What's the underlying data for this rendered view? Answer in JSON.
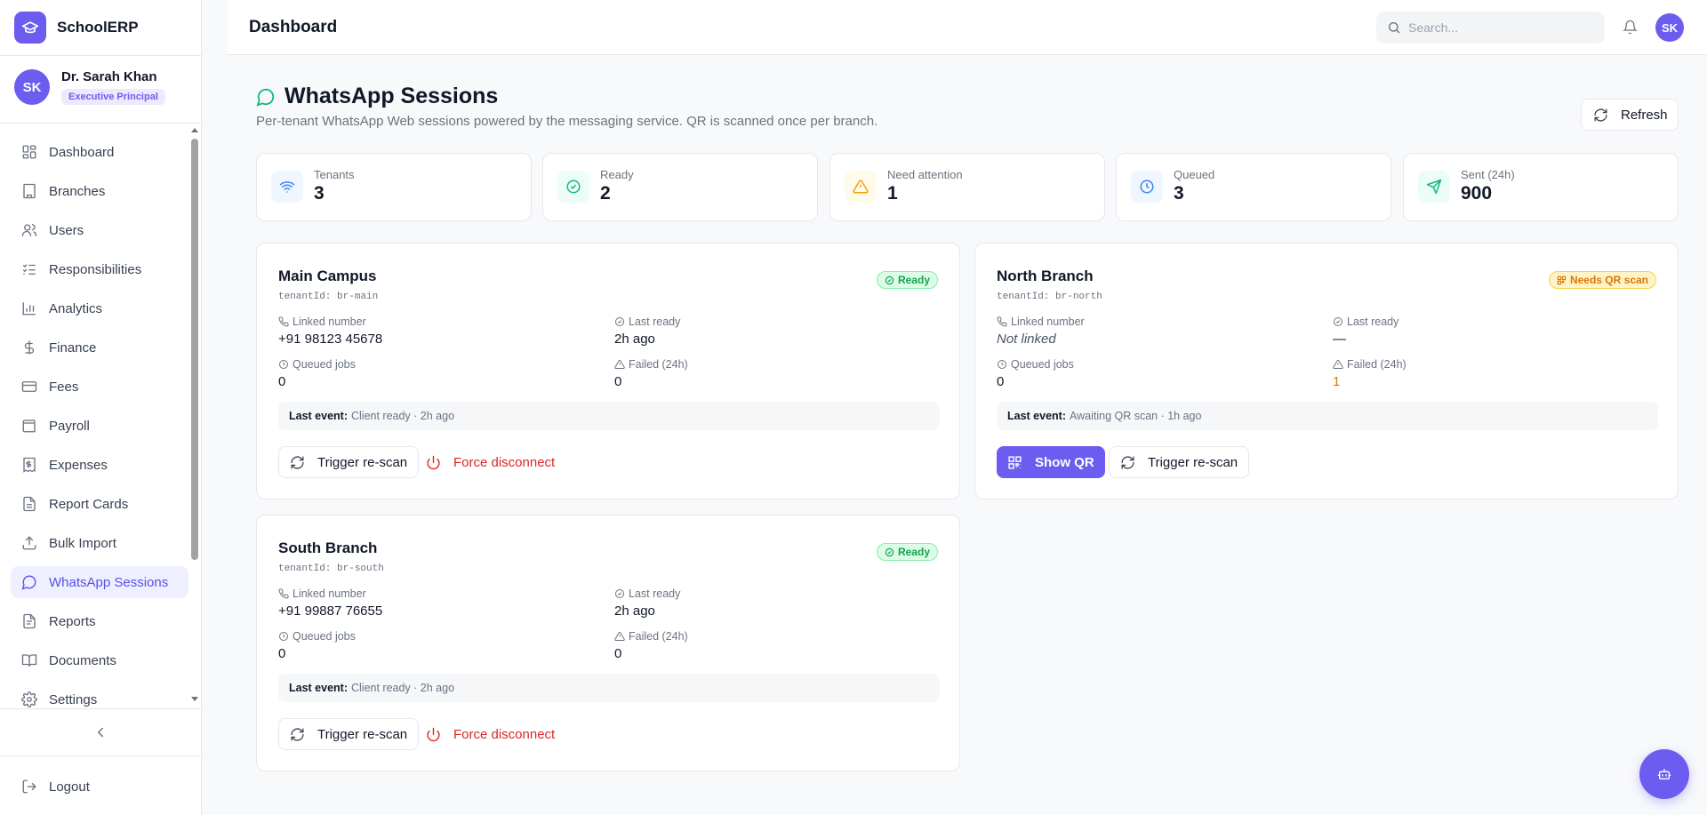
{
  "app": {
    "name": "SchoolERP",
    "brand_color": "#6d5cf0"
  },
  "profile": {
    "initials": "SK",
    "name": "Dr. Sarah Khan",
    "role": "Executive Principal"
  },
  "sidebar": {
    "items": [
      {
        "label": "Dashboard",
        "icon": "dashboard-icon"
      },
      {
        "label": "Branches",
        "icon": "building-icon"
      },
      {
        "label": "Users",
        "icon": "users-icon"
      },
      {
        "label": "Responsibilities",
        "icon": "list-checks-icon"
      },
      {
        "label": "Analytics",
        "icon": "bar-chart-icon"
      },
      {
        "label": "Finance",
        "icon": "dollar-icon"
      },
      {
        "label": "Fees",
        "icon": "credit-card-icon"
      },
      {
        "label": "Payroll",
        "icon": "wallet-icon"
      },
      {
        "label": "Expenses",
        "icon": "receipt-icon"
      },
      {
        "label": "Report Cards",
        "icon": "file-text-icon"
      },
      {
        "label": "Bulk Import",
        "icon": "upload-icon"
      },
      {
        "label": "WhatsApp Sessions",
        "icon": "message-circle-icon",
        "active": true
      },
      {
        "label": "Reports",
        "icon": "file-icon"
      },
      {
        "label": "Documents",
        "icon": "book-icon"
      },
      {
        "label": "Settings",
        "icon": "gear-icon"
      }
    ],
    "logout_label": "Logout"
  },
  "header": {
    "title": "Dashboard",
    "search_placeholder": "Search...",
    "avatar_initials": "SK"
  },
  "page": {
    "title": "WhatsApp Sessions",
    "subtitle": "Per-tenant WhatsApp Web sessions powered by the messaging service. QR is scanned once per branch.",
    "refresh_label": "Refresh"
  },
  "stats": [
    {
      "label": "Tenants",
      "value": "3",
      "icon": "wifi-icon",
      "color": "#3b82f6",
      "bg": "#eff6ff"
    },
    {
      "label": "Ready",
      "value": "2",
      "icon": "check-circle-icon",
      "color": "#10b981",
      "bg": "#ecfdf5"
    },
    {
      "label": "Need attention",
      "value": "1",
      "icon": "alert-triangle-icon",
      "color": "#f59e0b",
      "bg": "#fffbeb"
    },
    {
      "label": "Queued",
      "value": "3",
      "icon": "clock-icon",
      "color": "#3b82f6",
      "bg": "#eff6ff"
    },
    {
      "label": "Sent (24h)",
      "value": "900",
      "icon": "send-icon",
      "color": "#10b981",
      "bg": "#ecfdf5"
    }
  ],
  "field_labels": {
    "linked_number": "Linked number",
    "last_ready": "Last ready",
    "queued_jobs": "Queued jobs",
    "failed": "Failed (24h)",
    "last_event": "Last event:"
  },
  "sessions": [
    {
      "name": "Main Campus",
      "tenant": "tenantId: br-main",
      "status": "Ready",
      "linked_number": "+91 98123 45678",
      "last_ready": "2h ago",
      "queued_jobs": "0",
      "failed": "0",
      "last_event": "Client ready · 2h ago",
      "actions": {
        "rescan": "Trigger re-scan",
        "disconnect": "Force disconnect"
      }
    },
    {
      "name": "North Branch",
      "tenant": "tenantId: br-north",
      "status": "Needs QR scan",
      "linked_number": "Not linked",
      "last_ready": "—",
      "queued_jobs": "0",
      "failed": "1",
      "last_event": "Awaiting QR scan · 1h ago",
      "actions": {
        "show_qr": "Show QR",
        "rescan": "Trigger re-scan"
      }
    },
    {
      "name": "South Branch",
      "tenant": "tenantId: br-south",
      "status": "Ready",
      "linked_number": "+91 99887 76655",
      "last_ready": "2h ago",
      "queued_jobs": "0",
      "failed": "0",
      "last_event": "Client ready · 2h ago",
      "actions": {
        "rescan": "Trigger re-scan",
        "disconnect": "Force disconnect"
      }
    }
  ]
}
